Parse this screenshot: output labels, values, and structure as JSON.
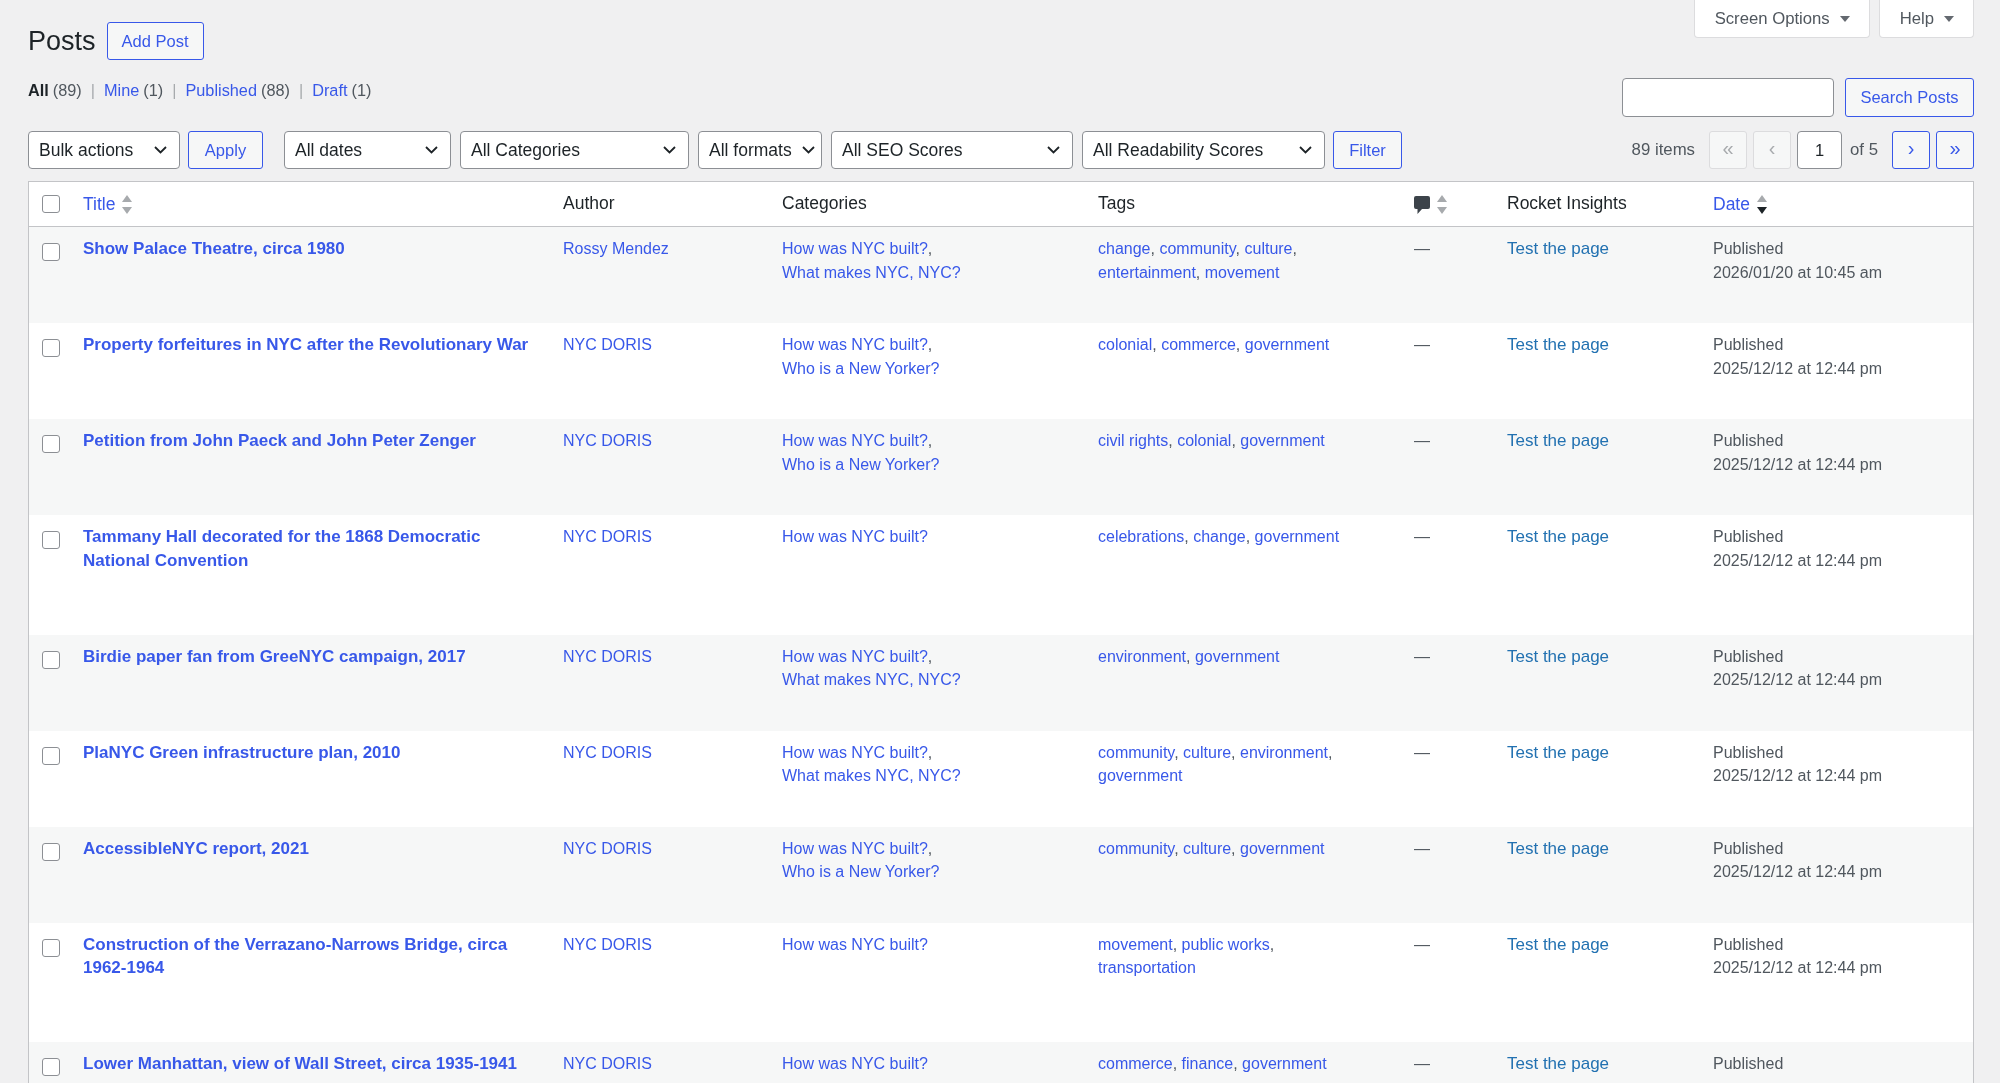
{
  "screen_meta": [
    {
      "label": "Screen Options"
    },
    {
      "label": "Help"
    }
  ],
  "header": {
    "title": "Posts",
    "add_button": "Add Post"
  },
  "status_filters": {
    "separator": "|",
    "items": [
      {
        "label": "All",
        "count": "(89)",
        "selected": true
      },
      {
        "label": "Mine",
        "count": "(1)",
        "selected": false
      },
      {
        "label": "Published",
        "count": "(88)",
        "selected": false
      },
      {
        "label": "Draft",
        "count": "(1)",
        "selected": false
      }
    ]
  },
  "search": {
    "button": "Search Posts"
  },
  "toolbar": {
    "bulk_actions": "Bulk actions",
    "apply_button": "Apply",
    "filters": [
      "All dates",
      "All Categories",
      "All formats",
      "All SEO Scores",
      "All Readability Scores"
    ],
    "filter_button": "Filter"
  },
  "pagination": {
    "count": "89 items",
    "buttons": [
      {
        "label": "«",
        "disabled": true
      },
      {
        "label": "‹",
        "disabled": true
      },
      {
        "label": "›",
        "disabled": false
      },
      {
        "label": "»",
        "disabled": false
      }
    ],
    "current_page": "1",
    "total": "of 5"
  },
  "table": {
    "list_separator": ",",
    "columns": [
      {
        "kind": "checkbox",
        "checked": false
      },
      {
        "kind": "sortable",
        "label": "Title",
        "sorted": false
      },
      {
        "kind": "plain",
        "label": "Author"
      },
      {
        "kind": "plain",
        "label": "Categories"
      },
      {
        "kind": "plain",
        "label": "Tags"
      },
      {
        "kind": "comments",
        "sorted": false
      },
      {
        "kind": "plain",
        "label": "Rocket Insights"
      },
      {
        "kind": "sortable",
        "label": "Date",
        "sorted": true
      }
    ],
    "rows": [
      {
        "checked": false,
        "title": "Show Palace Theatre, circa 1980",
        "author": "Rossy Mendez",
        "categories": [
          "How was NYC built?",
          "What makes NYC, NYC?"
        ],
        "tags": [
          "change",
          "community",
          "culture",
          "entertainment",
          "movement"
        ],
        "comments": "—",
        "insights": "Test the page",
        "status": "Published",
        "date": "2026/01/20 at 10:45 am"
      },
      {
        "checked": false,
        "title": "Property forfeitures in NYC after the Revolutionary War",
        "author": "NYC DORIS",
        "categories": [
          "How was NYC built?",
          "Who is a New Yorker?"
        ],
        "tags": [
          "colonial",
          "commerce",
          "government"
        ],
        "comments": "—",
        "insights": "Test the page",
        "status": "Published",
        "date": "2025/12/12 at 12:44 pm"
      },
      {
        "checked": false,
        "title": "Petition from John Paeck and John Peter Zenger",
        "author": "NYC DORIS",
        "categories": [
          "How was NYC built?",
          "Who is a New Yorker?"
        ],
        "tags": [
          "civil rights",
          "colonial",
          "government"
        ],
        "comments": "—",
        "insights": "Test the page",
        "status": "Published",
        "date": "2025/12/12 at 12:44 pm"
      },
      {
        "checked": false,
        "title": "Tammany Hall decorated for the 1868 Democratic National Convention",
        "author": "NYC DORIS",
        "categories": [
          "How was NYC built?"
        ],
        "tags": [
          "celebrations",
          "change",
          "government"
        ],
        "comments": "—",
        "insights": "Test the page",
        "status": "Published",
        "date": "2025/12/12 at 12:44 pm"
      },
      {
        "checked": false,
        "title": "Birdie paper fan from GreeNYC campaign, 2017",
        "author": "NYC DORIS",
        "categories": [
          "How was NYC built?",
          "What makes NYC, NYC?"
        ],
        "tags": [
          "environment",
          "government"
        ],
        "comments": "—",
        "insights": "Test the page",
        "status": "Published",
        "date": "2025/12/12 at 12:44 pm"
      },
      {
        "checked": false,
        "title": "PlaNYC Green infrastructure plan, 2010",
        "author": "NYC DORIS",
        "categories": [
          "How was NYC built?",
          "What makes NYC, NYC?"
        ],
        "tags": [
          "community",
          "culture",
          "environment",
          "government"
        ],
        "comments": "—",
        "insights": "Test the page",
        "status": "Published",
        "date": "2025/12/12 at 12:44 pm"
      },
      {
        "checked": false,
        "title": "AccessibleNYC report, 2021",
        "author": "NYC DORIS",
        "categories": [
          "How was NYC built?",
          "Who is a New Yorker?"
        ],
        "tags": [
          "community",
          "culture",
          "government"
        ],
        "comments": "—",
        "insights": "Test the page",
        "status": "Published",
        "date": "2025/12/12 at 12:44 pm"
      },
      {
        "checked": false,
        "title": "Construction of the Verrazano-Narrows Bridge, circa 1962-1964",
        "author": "NYC DORIS",
        "categories": [
          "How was NYC built?"
        ],
        "tags": [
          "movement",
          "public works",
          "transportation"
        ],
        "comments": "—",
        "insights": "Test the page",
        "status": "Published",
        "date": "2025/12/12 at 12:44 pm"
      },
      {
        "checked": false,
        "title": "Lower Manhattan, view of Wall Street, circa 1935-1941",
        "author": "NYC DORIS",
        "categories": [
          "How was NYC built?"
        ],
        "tags": [
          "commerce",
          "finance",
          "government"
        ],
        "comments": "—",
        "insights": "Test the page",
        "status": "Published"
      }
    ]
  }
}
